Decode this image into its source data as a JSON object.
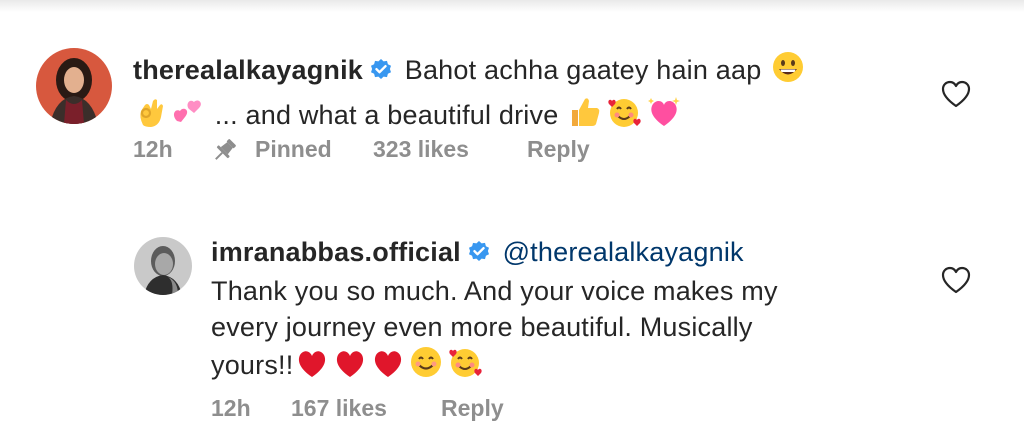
{
  "comments": [
    {
      "username": "therealalkayagnik",
      "verified": true,
      "text_line1": "Bahot achha gaatey hain aap",
      "emoji_line1": [
        "grinning-face"
      ],
      "emoji_line2_prefix": [
        "ok-hand",
        "two-hearts"
      ],
      "text_line2": "... and what a beautiful drive",
      "emoji_line2_suffix": [
        "thumbs-up",
        "smiling-face-with-hearts",
        "sparkling-heart"
      ],
      "time": "12h",
      "pinned_label": "Pinned",
      "likes": "323 likes",
      "reply_label": "Reply",
      "like_icon": "heart-outline-icon"
    },
    {
      "username": "imranabbas.official",
      "verified": true,
      "mention": "@therealalkayagnik",
      "text_line1": "Thank you so much. And your voice makes my",
      "text_line2": "every journey even more beautiful. Musically",
      "text_line3": "yours!!",
      "emoji_line3": [
        "red-heart",
        "red-heart",
        "red-heart",
        "smiling-face",
        "smiling-face-with-hearts"
      ],
      "time": "12h",
      "likes": "167 likes",
      "reply_label": "Reply",
      "like_icon": "heart-outline-icon"
    }
  ],
  "colors": {
    "username": "#262626",
    "meta": "#8e8e8e",
    "verified": "#3897f0",
    "mention": "#00376b"
  }
}
